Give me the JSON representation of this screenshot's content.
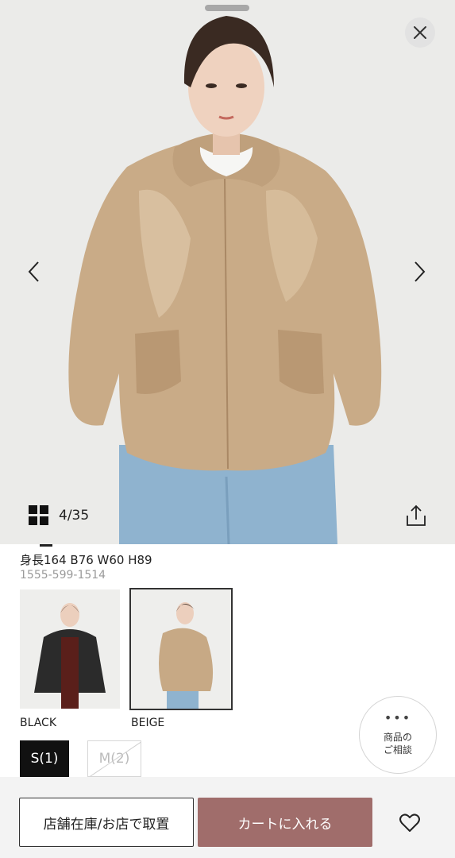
{
  "hero": {
    "image": "model-beige-hooded-jacket-front",
    "counter": "4/35",
    "icons": {
      "close": "close-icon",
      "prev": "chevron-left-icon",
      "next": "chevron-right-icon",
      "grid": "grid-icon",
      "share": "share-icon"
    }
  },
  "product": {
    "model_info": "身長164 B76 W60 H89",
    "code": "1555-599-1514"
  },
  "colors": [
    {
      "label": "BLACK",
      "swatch_color": "#2b2b2b",
      "selected": false
    },
    {
      "label": "BEIGE",
      "swatch_color": "#c7a985",
      "selected": true
    }
  ],
  "sizes": [
    {
      "label": "S(1)",
      "selected": true,
      "available": true
    },
    {
      "label": "M(2)",
      "selected": false,
      "available": false
    }
  ],
  "consult": {
    "line1": "商品の",
    "line2": "ご相談"
  },
  "actions": {
    "store_stock": "店舗在庫/お店で取置",
    "add_to_cart": "カートに入れる",
    "favorite_icon": "heart-icon"
  },
  "theme": {
    "cart_color": "#a06d6b",
    "selected_size_bg": "#111111"
  }
}
